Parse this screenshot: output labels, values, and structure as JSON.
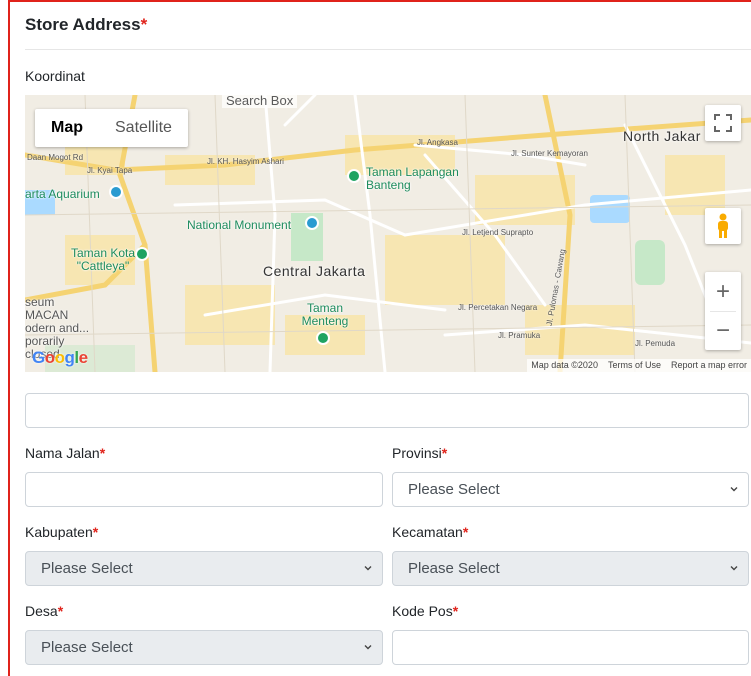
{
  "section": {
    "title": "Store Address",
    "required_mark": "*"
  },
  "coordinates": {
    "label": "Koordinat"
  },
  "map": {
    "search_box_label": "Search Box",
    "map_type": {
      "map_label": "Map",
      "satellite_label": "Satellite"
    },
    "places": {
      "north_jakarta": "North Jakar",
      "central_jakarta": "Central Jakarta",
      "taman_lapangan_banteng": "Taman Lapangan Banteng",
      "national_monument": "National Monument",
      "aquarium": "arta Aquarium",
      "taman_kota_cattleya": "Taman Kota \"Cattleya\"",
      "taman_menteng": "Taman Menteng",
      "museum_macan": "seum MACAN odern and... porarily closed"
    },
    "roads": {
      "kh_hasyim_ashari": "Jl. KH. Hasyim Ashari",
      "kyai_tapa": "Jl. Kyai Tapa",
      "letjend_suprapto": "Jl. Letjend Suprapto",
      "pulomas_cawang": "Jl. Pulomas - Cawang",
      "percetakan_negara": "Jl. Percetakan Negara",
      "pramuka": "Jl. Pramuka",
      "pemuda": "Jl. Pemuda",
      "angkasa": "Jl. Angkasa",
      "sunter_kemayoran": "Jl. Sunter Kemayoran",
      "dean_mogot": "Daan Mogot Rd"
    },
    "google_logo": {
      "g1": "G",
      "o1": "o",
      "o2": "o",
      "g2": "g",
      "l": "l",
      "e": "e"
    },
    "attribution": {
      "data": "Map data ©2020",
      "terms": "Terms of Use",
      "report": "Report a map error"
    },
    "zoom": {
      "in": "+",
      "out": "−"
    }
  },
  "address_search": {
    "value": "",
    "placeholder": ""
  },
  "fields": {
    "nama_jalan": {
      "label": "Nama Jalan",
      "value": ""
    },
    "provinsi": {
      "label": "Provinsi",
      "selected": "Please Select"
    },
    "kabupaten": {
      "label": "Kabupaten",
      "selected": "Please Select"
    },
    "kecamatan": {
      "label": "Kecamatan",
      "selected": "Please Select"
    },
    "desa": {
      "label": "Desa",
      "selected": "Please Select"
    },
    "kode_pos": {
      "label": "Kode Pos",
      "value": ""
    }
  },
  "colors": {
    "required": "#e0231b",
    "frame": "#e0231b",
    "park": "#c6e8c8",
    "water": "#aadaff"
  },
  "icons": [
    "fullscreen-icon",
    "pegman-icon",
    "chevron-down-icon",
    "map-pin-icon",
    "transit-icon"
  ]
}
